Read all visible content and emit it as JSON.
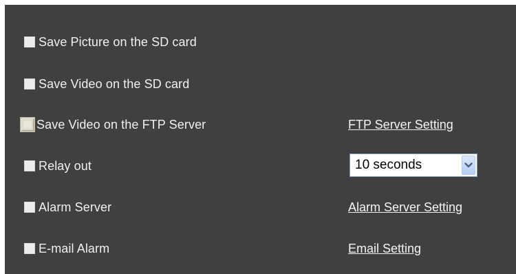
{
  "options": [
    {
      "label": "Save Picture on the SD card"
    },
    {
      "label": "Save Video on the SD card"
    },
    {
      "label": "Save Video on the FTP Server",
      "link": "FTP Server Setting"
    },
    {
      "label": "Relay out",
      "select_value": "10 seconds"
    },
    {
      "label": "Alarm Server",
      "link": "Alarm Server Setting"
    },
    {
      "label": "E-mail Alarm",
      "link": "Email Setting"
    }
  ],
  "colors": {
    "panel_background": "#404040",
    "text": "#f0f0f0"
  },
  "icons": {
    "select_arrow": "chevron-down-icon"
  }
}
